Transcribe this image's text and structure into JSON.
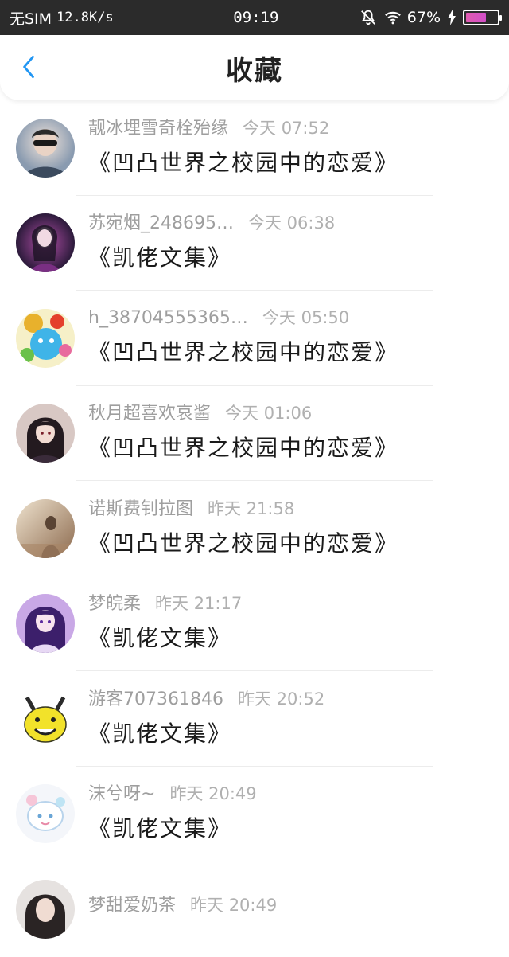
{
  "status_bar": {
    "carrier": "无SIM",
    "speed": "12.8K/s",
    "time": "09:19",
    "battery": "67%",
    "battery_level": 0.67,
    "icons": [
      "mute-bell-icon",
      "wifi-icon",
      "charging-icon",
      "battery-icon"
    ]
  },
  "header": {
    "back_icon": "chevron-left-icon",
    "title": "收藏"
  },
  "colors": {
    "accent": "#2196f3",
    "name_gray": "#9e9e9e",
    "title_black": "#1a1a1a"
  },
  "favorites": [
    {
      "user": "靓冰埋雪奇栓殆缘",
      "time": "今天 07:52",
      "title": "《凹凸世界之校园中的恋爱》",
      "avatar": "avatar-boy-photo"
    },
    {
      "user": "苏宛烟_248695…",
      "time": "今天 06:38",
      "title": "《凯佬文集》",
      "avatar": "avatar-anime-purple"
    },
    {
      "user": "h_38704555365…",
      "time": "今天 05:50",
      "title": "《凹凸世界之校园中的恋爱》",
      "avatar": "avatar-candy-cartoon"
    },
    {
      "user": "秋月超喜欢哀酱",
      "time": "今天 01:06",
      "title": "《凹凸世界之校园中的恋爱》",
      "avatar": "avatar-anime-dark"
    },
    {
      "user": "诺斯费钊拉图",
      "time": "昨天 21:58",
      "title": "《凹凸世界之校园中的恋爱》",
      "avatar": "avatar-sepia-photo"
    },
    {
      "user": "梦皖柔",
      "time": "昨天 21:17",
      "title": "《凯佬文集》",
      "avatar": "avatar-anime-violet"
    },
    {
      "user": "游客707361846",
      "time": "昨天 20:52",
      "title": "《凯佬文集》",
      "avatar": "avatar-yellow-meme"
    },
    {
      "user": "沫兮呀~",
      "time": "昨天 20:49",
      "title": "《凯佬文集》",
      "avatar": "avatar-pastel-cartoon"
    },
    {
      "user": "梦甜爱奶茶",
      "time": "昨天 20:49",
      "title": "",
      "avatar": "avatar-girl-photo"
    }
  ]
}
